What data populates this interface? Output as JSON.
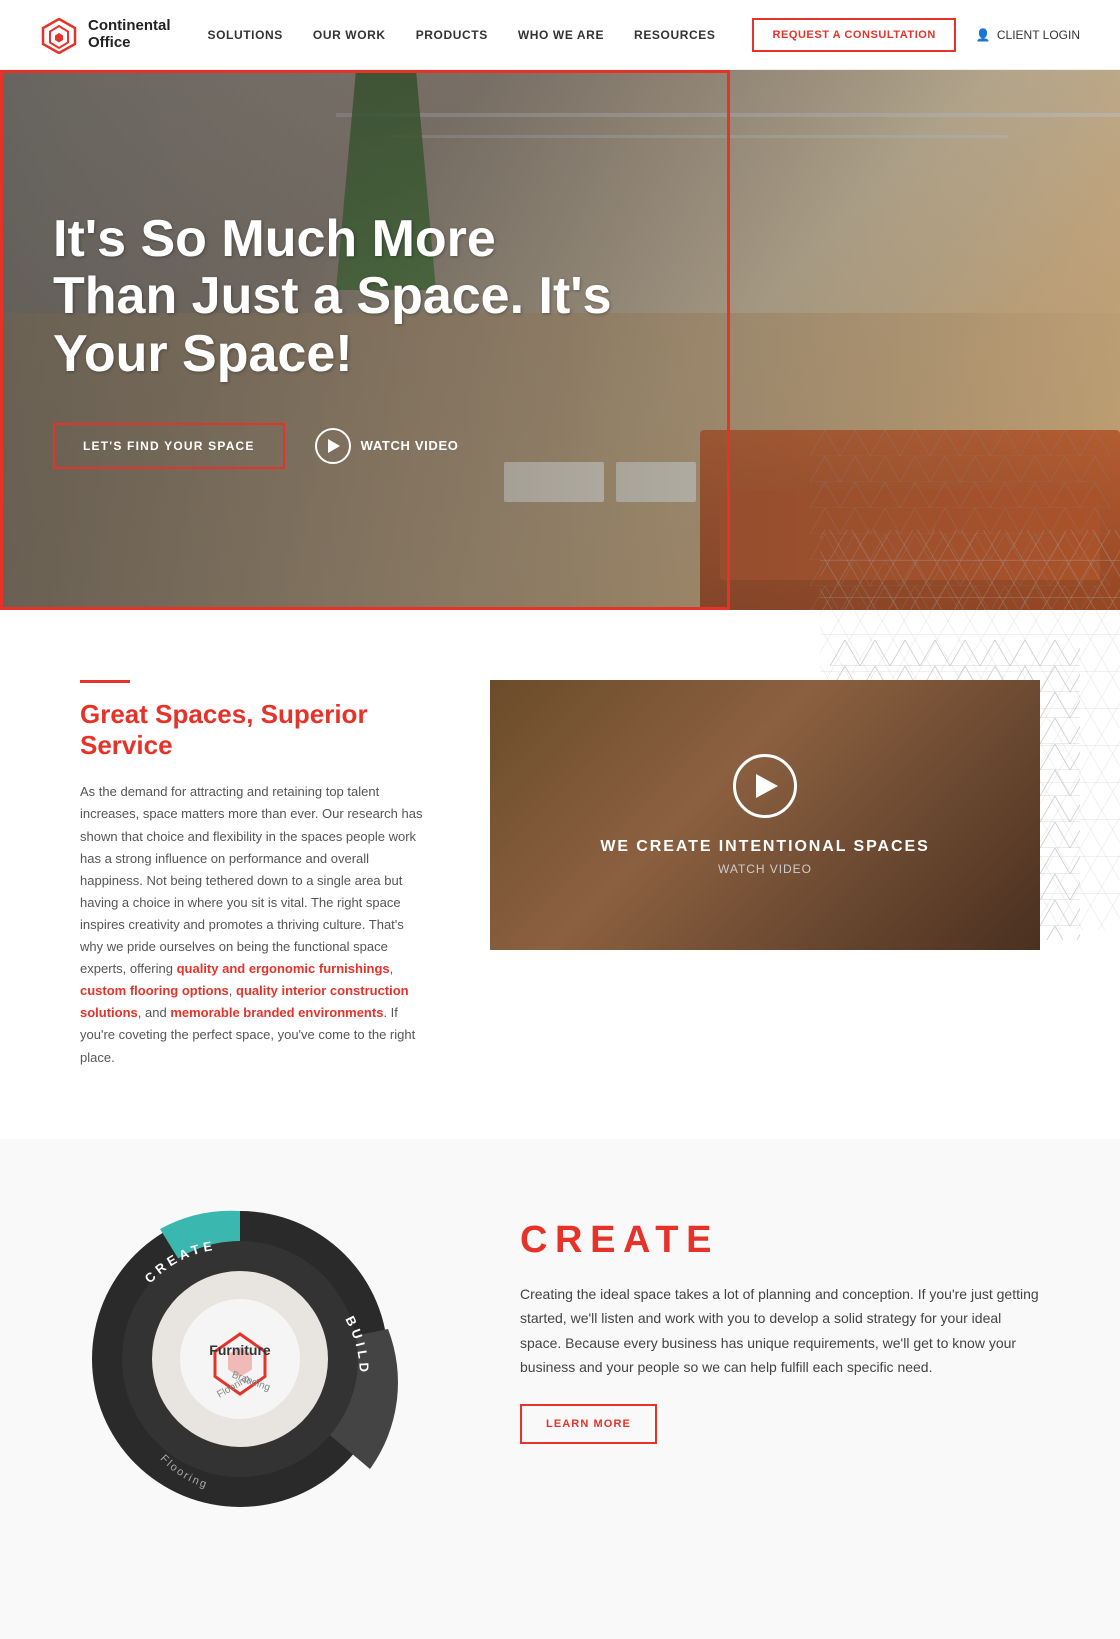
{
  "brand": {
    "name_line1": "Continental",
    "name_line2": "Office",
    "logo_icon": "◈"
  },
  "nav": {
    "links": [
      {
        "label": "SOLUTIONS",
        "id": "solutions"
      },
      {
        "label": "OUR WORK",
        "id": "our-work"
      },
      {
        "label": "PRODUCTS",
        "id": "products"
      },
      {
        "label": "WHO WE ARE",
        "id": "who-we-are"
      },
      {
        "label": "RESOURCES",
        "id": "resources"
      }
    ],
    "cta_label": "REQUEST A CONSULTATION",
    "client_login": "CLIENT LOGIN"
  },
  "hero": {
    "title": "It's So Much More Than Just a Space. It's Your Space!",
    "cta_label": "LET'S FIND YOUR SPACE",
    "watch_video_label": "WATCH VIDEO"
  },
  "great_spaces": {
    "rule": "",
    "heading": "Great Spaces, Superior Service",
    "body_plain1": "As the demand for attracting and retaining top talent increases, space matters more than ever. Our research has shown that choice and flexibility in the spaces people work has a strong influence on performance and overall happiness. Not being tethered down to a single area but having a choice in where you sit is vital. The right space inspires creativity and promotes a thriving culture. That's why we pride ourselves on being the functional space experts, offering ",
    "link1": "quality and ergonomic furnishings",
    "body_plain2": ", ",
    "link2": "custom flooring options",
    "body_plain3": ", ",
    "link3": "quality interior construction solutions",
    "body_plain4": ", and ",
    "link4": "memorable branded environments",
    "body_plain5": ". If you're coveting the perfect space, you've come to the right place."
  },
  "video": {
    "title": "WE CREATE INTENTIONAL SPACES",
    "subtitle": "WATCH VIDEO"
  },
  "create_section": {
    "heading": "CREATE",
    "body": "Creating the ideal space takes a lot of planning and conception. If you're just getting started, we'll listen and work with you to develop a solid strategy for your ideal space. Because every business has unique requirements, we'll get to know your business and your people so we can help fulfill each specific need.",
    "cta_label": "LEARN MORE",
    "wheel_labels": [
      "CREATE",
      "BUILD",
      "Furniture",
      "Flooring",
      "Branding"
    ]
  }
}
